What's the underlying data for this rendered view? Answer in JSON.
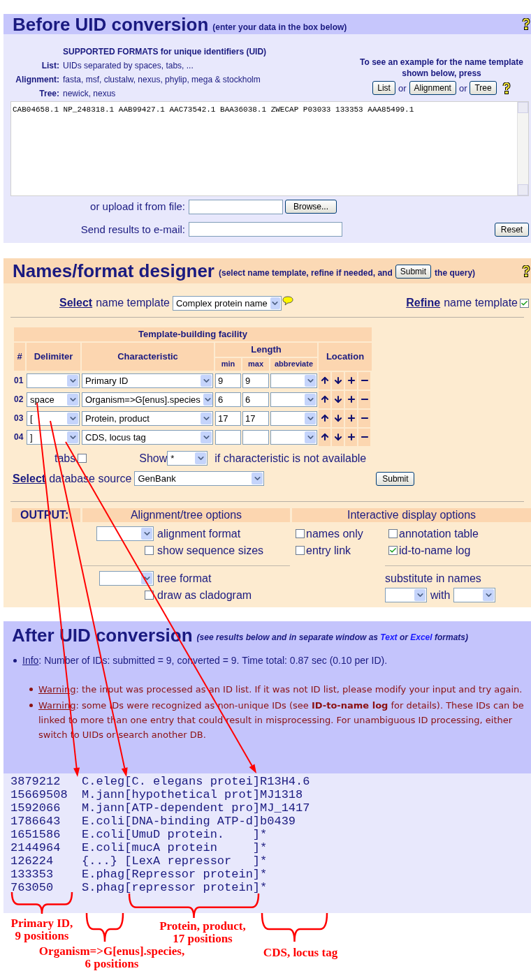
{
  "before": {
    "title": "Before UID conversion",
    "subtitle": "(enter your data in the box below)",
    "formats_heading": "SUPPORTED FORMATS for unique identifiers (UID)",
    "formats": [
      {
        "label": "List:",
        "value": "UIDs separated by spaces, tabs, ..."
      },
      {
        "label": "Alignment:",
        "value": "fasta, msf, clustalw, nexus, phylip, mega & stockholm"
      },
      {
        "label": "Tree:",
        "value": "newick, nexus"
      }
    ],
    "example_hint": "To see an example for the name template shown below, press",
    "example_buttons": [
      {
        "label": "List",
        "connector": "or"
      },
      {
        "label": "Alignment",
        "connector": "or"
      },
      {
        "label": "Tree"
      }
    ],
    "input_value": "CAB04658.1 NP_248318.1 AAB99427.1 AAC73542.1 BAA36038.1 ZWECAP P03033 133353 AAA85499.1",
    "upload_label": "or upload it from file:",
    "browse_button": "Browse...",
    "email_label": "Send results to e-mail:",
    "reset_button": "Reset"
  },
  "designer": {
    "title": "Names/format designer",
    "subtitle_before": "(select name template, refine if needed, and",
    "subtitle_button": "Submit",
    "subtitle_after": "the query)",
    "select_link": "Select",
    "select_label": "name template",
    "template_value": "Complex protein name",
    "refine_link": "Refine",
    "refine_label": "name template",
    "refine_checked": true,
    "table": {
      "caption": "Template-building facility",
      "number_column": "#",
      "delimiter_column": "Delimiter",
      "characteristic_column": "Characteristic",
      "length_column": "Length",
      "length_subcolumns": [
        "min",
        "max",
        "abbreviate"
      ],
      "location_column": "Location",
      "rows": [
        {
          "number": "01",
          "characteristic": "Primary ID",
          "min": "9",
          "max": "9"
        },
        {
          "number": "02",
          "delimiter": "space",
          "characteristic": "Organism=>G[enus].species",
          "min": "6",
          "max": "6"
        },
        {
          "number": "03",
          "delimiter": "[",
          "characteristic": "Protein, product",
          "min": "17",
          "max": "17"
        },
        {
          "number": "04",
          "delimiter": "]",
          "characteristic": "CDS, locus tag"
        }
      ]
    },
    "tabs_label": "tabs",
    "tabs_checked": false,
    "show_label": "Show",
    "show_value": "*",
    "show_suffix": "if characteristic is not available",
    "db_link": "Select",
    "db_label": "database source",
    "db_value": "GenBank",
    "submit_button": "Submit"
  },
  "output": {
    "label": "OUTPUT:",
    "alignment_heading": "Alignment/tree options",
    "interactive_heading": "Interactive display options",
    "alignment_options": [
      {
        "kind": "select",
        "label": "alignment format"
      },
      {
        "kind": "checkbox",
        "label": "show sequence sizes",
        "checked": false
      }
    ],
    "tree_options": [
      {
        "kind": "select",
        "label": "tree format"
      },
      {
        "kind": "checkbox",
        "label": "draw as cladogram",
        "checked": false
      }
    ],
    "display_options": [
      {
        "label": "names only",
        "checked": false
      },
      {
        "label": "annotation table",
        "checked": false
      },
      {
        "label": "entry link",
        "checked": false
      },
      {
        "label": "id-to-name log",
        "checked": true
      }
    ],
    "substitute_label": "substitute in names",
    "with_label": "with"
  },
  "after": {
    "title": "After UID conversion",
    "subtitle_parts": [
      {
        "kind": "text",
        "text": "(see results below and in separate window as "
      },
      {
        "kind": "link",
        "text": "Text"
      },
      {
        "kind": "text",
        "text": " or "
      },
      {
        "kind": "link",
        "text": "Excel"
      },
      {
        "kind": "text",
        "text": " formats)"
      }
    ],
    "info": {
      "link": "Info",
      "text": ": Number of IDs: submitted = 9, converted = 9. Time total: 0.87 sec (0.10 per ID)."
    },
    "warnings": [
      {
        "link": "Warning",
        "text": ": the input was processed as an ID list. If it was not ID list, please modify your input and try again."
      },
      {
        "link": "Warning",
        "text": ": some IDs were recognized as non-unique IDs (see **ID-to-name log** for details). These IDs can be linked to more than one entry that could result in misprocessing. For unambiguous ID processing, either switch to UIDs or search another DB."
      }
    ],
    "results": [
      "3879212   C.eleg[C. elegans protei]R13H4.6",
      "15669508  M.jann[hypothetical prot]MJ1318",
      "1592066   M.jann[ATP-dependent pro]MJ_1417",
      "1786643   E.coli[DNA-binding ATP-d]b0439",
      "1651586   E.coli[UmuD protein.    ]*",
      "2144964   E.coli[mucA protein     ]*",
      "126224    {...} [LexA repressor   ]*",
      "133353    E.phag[Repressor protein]*",
      "763050    S.phag[repressor protein]*"
    ]
  },
  "annotations": [
    {
      "lines": [
        "Primary ID,",
        "9 positions"
      ]
    },
    {
      "lines": [
        "Organism=>G[enus].species,",
        "6 positions"
      ]
    },
    {
      "lines": [
        "Protein, product,",
        "17 positions"
      ]
    },
    {
      "lines": [
        "CDS, locus tag"
      ]
    }
  ]
}
